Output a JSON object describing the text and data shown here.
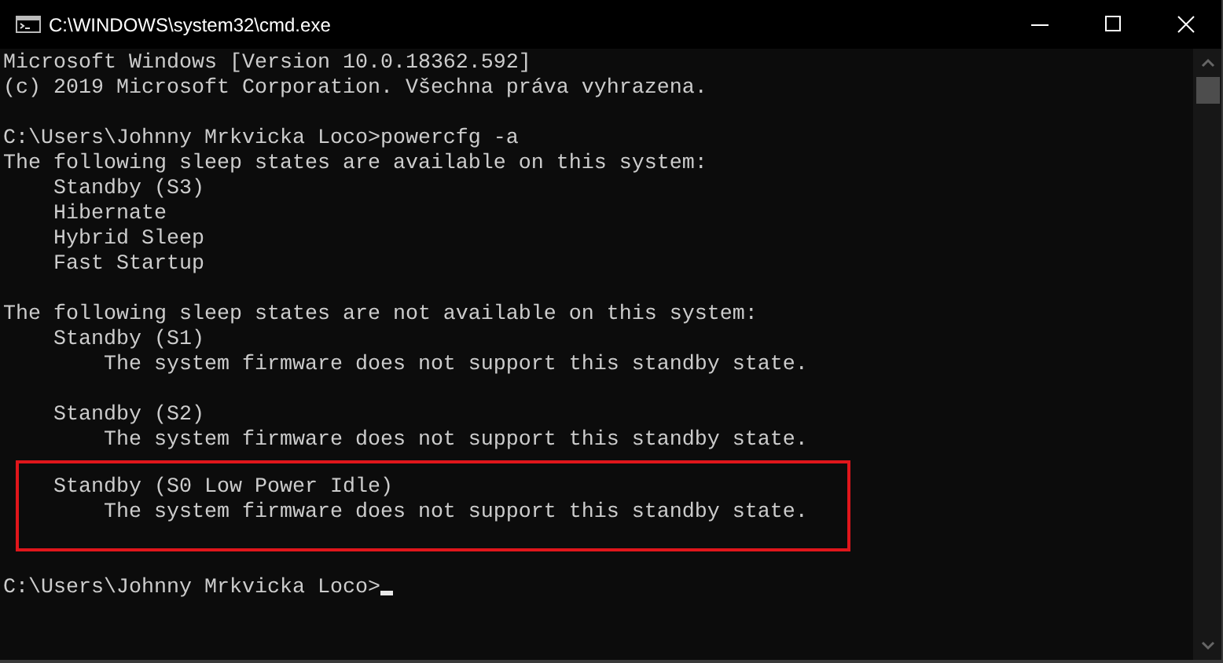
{
  "window": {
    "title": "C:\\WINDOWS\\system32\\cmd.exe"
  },
  "console": {
    "blocks": [
      {
        "highlighted": false,
        "lines": [
          "Microsoft Windows [Version 10.0.18362.592]",
          "(c) 2019 Microsoft Corporation. Všechna práva vyhrazena."
        ]
      },
      {
        "highlighted": false,
        "lines": [
          "C:\\Users\\Johnny Mrkvicka Loco>powercfg -a",
          "The following sleep states are available on this system:",
          "    Standby (S3)",
          "    Hibernate",
          "    Hybrid Sleep",
          "    Fast Startup"
        ]
      },
      {
        "highlighted": false,
        "lines": [
          "The following sleep states are not available on this system:",
          "    Standby (S1)",
          "        The system firmware does not support this standby state."
        ]
      },
      {
        "highlighted": false,
        "lines": [
          "    Standby (S2)",
          "        The system firmware does not support this standby state."
        ]
      },
      {
        "highlighted": true,
        "lines": [
          "    Standby (S0 Low Power Idle)",
          "        The system firmware does not support this standby state."
        ]
      }
    ],
    "prompt": {
      "text": "C:\\Users\\Johnny Mrkvicka Loco>",
      "cursor": true
    }
  }
}
